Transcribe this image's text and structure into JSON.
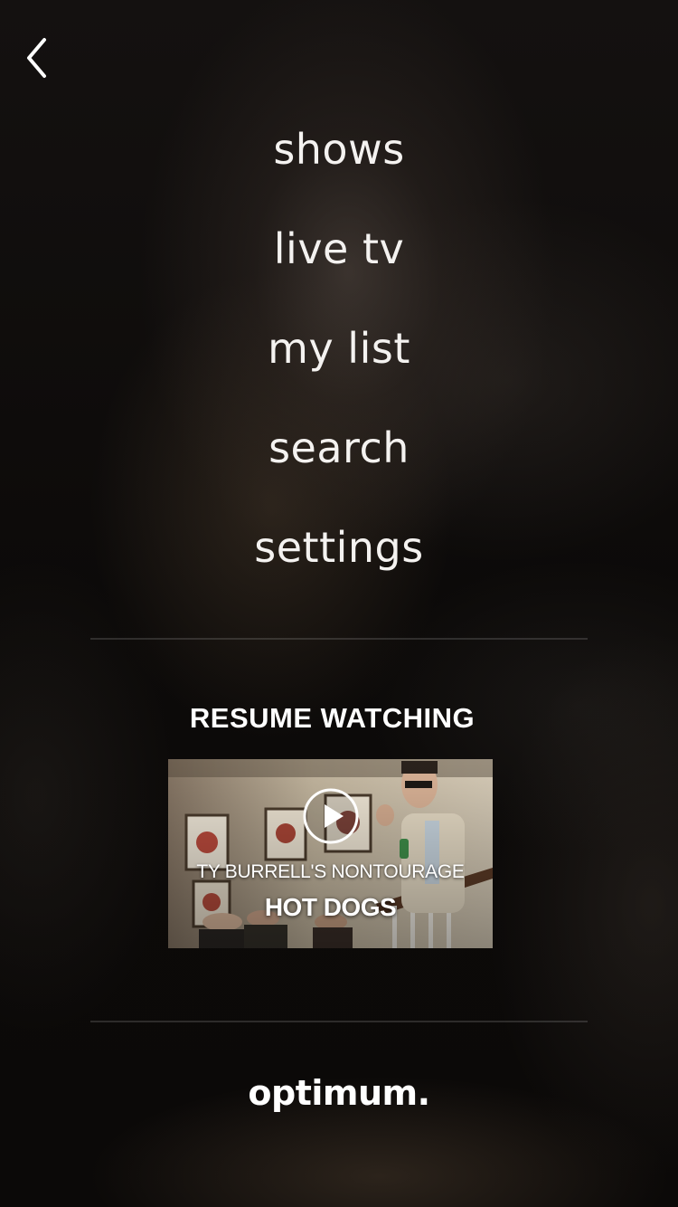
{
  "navigation": {
    "back_icon": "chevron-left-icon"
  },
  "menu": {
    "items": [
      {
        "label": "shows"
      },
      {
        "label": "live tv"
      },
      {
        "label": "my list"
      },
      {
        "label": "search"
      },
      {
        "label": "settings"
      }
    ]
  },
  "resume": {
    "heading": "RESUME WATCHING",
    "show_title": "TY BURRELL'S NONTOURAGE",
    "episode_title": "HOT DOGS",
    "play_icon": "play-icon"
  },
  "brand": {
    "logo_text": "optimum."
  },
  "colors": {
    "text": "#f4f2f0",
    "background": "#0b0908",
    "divider": "#2a2624"
  }
}
